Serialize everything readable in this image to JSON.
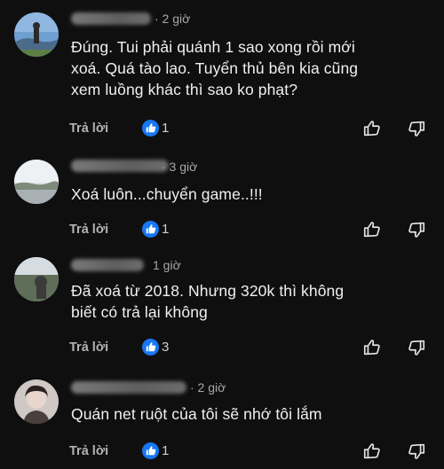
{
  "colors": {
    "background": "#0f0f10",
    "text": "#f0f0f0",
    "muted": "#a8a8a8",
    "like_badge": "#1877f2"
  },
  "comments": [
    {
      "time": "· 2 giờ",
      "text_line1": "Đúng. Tui phải quánh 1 sao xong rồi mới",
      "text_line2": "xoá. Quá tào lao. Tuyển thủ bên kia cũng",
      "text_line3": "xem luồng khác thì sao ko phạt?",
      "reply_label": "Trả lời",
      "like_count": "1",
      "icons": [
        "like-badge-icon",
        "thumb-up-icon",
        "thumb-down-icon"
      ]
    },
    {
      "time": "· 3 giờ",
      "text_line1": "Xoá luôn...chuyển game..!!!",
      "reply_label": "Trả lời",
      "like_count": "1",
      "icons": [
        "like-badge-icon",
        "thumb-up-icon",
        "thumb-down-icon"
      ]
    },
    {
      "time": "1 giờ",
      "text_line1": "Đã xoá từ 2018. Nhưng 320k thì không",
      "text_line2": "biết có trả lại không",
      "reply_label": "Trả lời",
      "like_count": "3",
      "icons": [
        "like-badge-icon",
        "thumb-up-icon",
        "thumb-down-icon"
      ]
    },
    {
      "time": "· 2 giờ",
      "text_line1": "Quán net ruột của tôi sẽ nhớ tôi lắm",
      "reply_label": "Trả lời",
      "like_count": "1",
      "icons": [
        "like-badge-icon",
        "thumb-up-icon",
        "thumb-down-icon"
      ]
    }
  ]
}
